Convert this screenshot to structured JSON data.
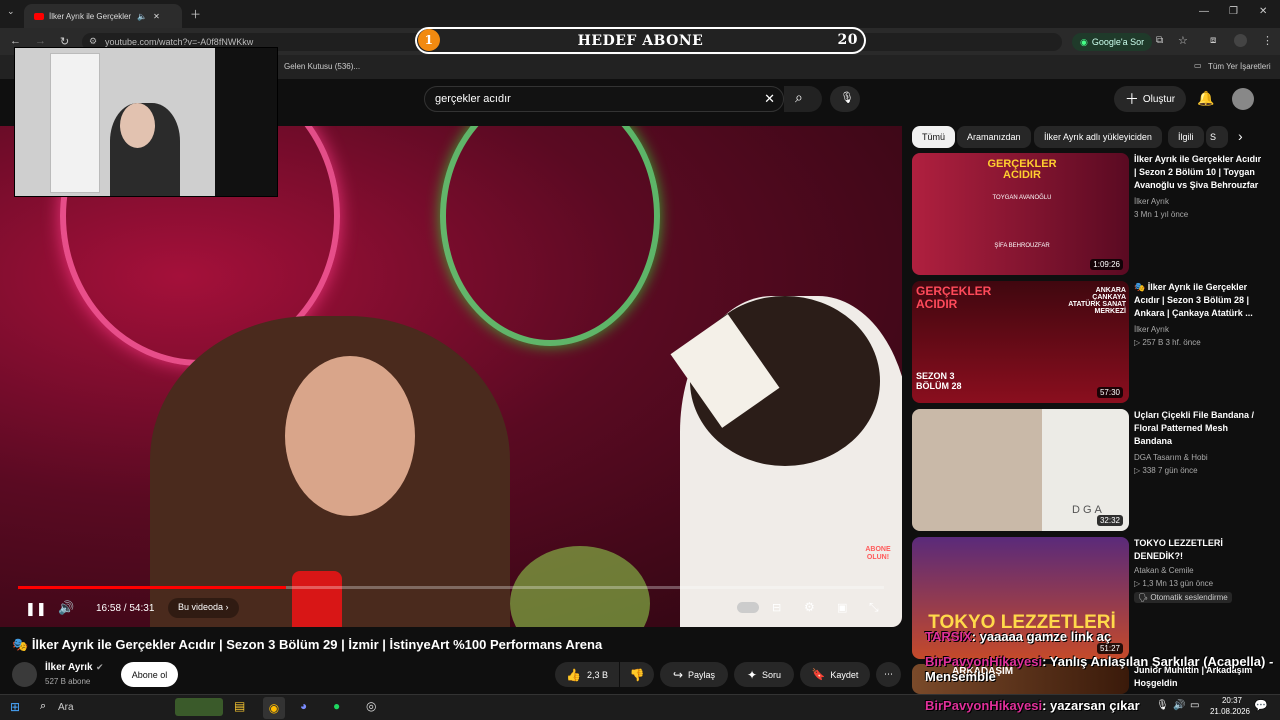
{
  "browser": {
    "tab_title": "İlker Ayrık ile Gerçekler",
    "url": "youtube.com/watch?v=-A0f8fNWKkw",
    "google_sor": "Google'a Sor",
    "bookmark_inbox": "Gelen Kutusu (536)...",
    "bookmarks_all": "Tüm Yer İşaretleri"
  },
  "goal_overlay": {
    "current": "1",
    "title": "HEDEF ABONE",
    "target": "20"
  },
  "search": {
    "query": "gerçekler acıdır"
  },
  "header": {
    "create_label": "Oluştur"
  },
  "player": {
    "time": "16:58 / 54:31",
    "in_video_label": "Bu videoda",
    "progress": 0.31,
    "abone_badge": "ABONE OLUN!"
  },
  "video": {
    "title": "İlker Ayrık ile Gerçekler Acıdır | Sezon 3 Bölüm 29 | İzmir | İstinyeArt %100 Performans Arena",
    "channel": "İlker Ayrık",
    "subscribers": "527 B abone",
    "subscribe_label": "Abone ol",
    "likes": "2,3 B",
    "share_label": "Paylaş",
    "ask_label": "Soru",
    "save_label": "Kaydet"
  },
  "chips": [
    "Tümü",
    "Aramanızdan",
    "İlker Ayrık adlı yükleyiciden",
    "İlgili",
    "S"
  ],
  "recommendations": [
    {
      "title": "İlker Ayrık ile Gerçekler Acıdır | Sezon 2 Bölüm 10 | Toygan Avanoğlu vs Şiva Behrouzfar",
      "channel": "İlker Ayrık",
      "meta": "3 Mn  1 yıl önce",
      "duration": "1:09:26",
      "thumb_title": "GERÇEKLER ACIDIR",
      "thumb_sub": "TOYGAN AVANOĞLU",
      "thumb_sub2": "ŞİFA BEHROUZFAR",
      "color": "#8e1a3a"
    },
    {
      "title": "🎭 İlker Ayrık ile Gerçekler Acıdır | Sezon 3 Bölüm 28 | Ankara | Çankaya Atatürk ...",
      "channel": "İlker Ayrık",
      "meta": "▷ 257 B  3 hf. önce",
      "duration": "57:30",
      "thumb_title": "GERÇEKLER ACIDIR",
      "thumb_sub": "ANKARA ÇANKAYA ATATÜRK SANAT MERKEZİ",
      "thumb_sub2": "SEZON 3 BÖLÜM 28",
      "color": "#6a0b1c"
    },
    {
      "title": "Uçları Çiçekli File Bandana / Floral Patterned Mesh Bandana",
      "channel": "DGA Tasarım & Hobi",
      "meta": "▷ 338  7 gün önce",
      "duration": "32:32",
      "thumb_title": "DGA",
      "thumb_sub": "",
      "thumb_sub2": "",
      "color": "#cfc4b8"
    },
    {
      "title": "TOKYO LEZZETLERİ DENEDİK?!",
      "channel": "Atakan & Cemile",
      "meta": "▷ 1,3 Mn  13 gün önce",
      "duration": "51:27",
      "badge": "Otomatik seslendirme",
      "thumb_title": "TOKYO LEZZETLERİ",
      "thumb_sub": "",
      "thumb_sub2": "",
      "color": "#4a2a6a"
    },
    {
      "title": "Junior Muhittin | Arkadaşım Hoşgeldin",
      "channel": "",
      "meta": "",
      "duration": "",
      "thumb_title": "ARKADAŞIM",
      "thumb_sub": "",
      "thumb_sub2": "",
      "color": "#6a3a1a"
    }
  ],
  "chat_overlays": [
    {
      "user": "TARSIX",
      "text": ": yaaaaa gamze link aç"
    },
    {
      "user": "BirPavyonHikayesi",
      "text": ": Yanlış Anlaşılan Şarkılar (Acapella) - Mensemble"
    },
    {
      "user": "BirPavyonHikayesi",
      "text": ": yazarsan çıkar"
    }
  ],
  "taskbar": {
    "search_label": "Ara",
    "time": "20:37",
    "date": "21.08.2026"
  }
}
